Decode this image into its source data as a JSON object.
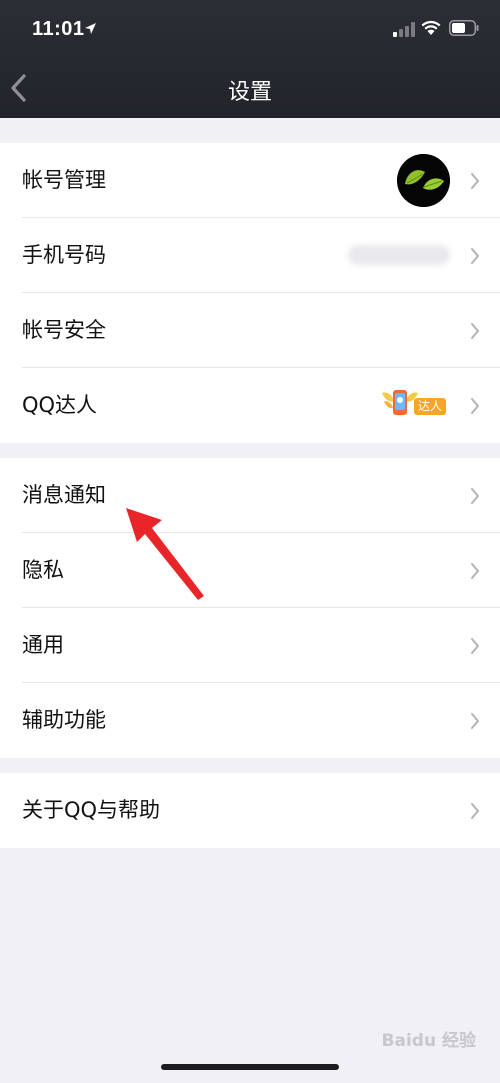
{
  "status_bar": {
    "time": "11:01"
  },
  "header": {
    "title": "设置"
  },
  "groups": [
    {
      "items": [
        {
          "label": "帐号管理"
        },
        {
          "label": "手机号码"
        },
        {
          "label": "帐号安全"
        },
        {
          "label": "QQ达人",
          "badge": "达人"
        }
      ]
    },
    {
      "items": [
        {
          "label": "消息通知"
        },
        {
          "label": "隐私"
        },
        {
          "label": "通用"
        },
        {
          "label": "辅助功能"
        }
      ]
    },
    {
      "items": [
        {
          "label": "关于QQ与帮助"
        }
      ]
    }
  ],
  "watermark": "Baidu 经验",
  "colors": {
    "header_bg": "#22242b",
    "page_bg": "#f0f0f5",
    "arrow": "#e8262a",
    "badge": "#f5a623"
  },
  "icons": [
    "location-arrow-icon",
    "signal-icon",
    "wifi-icon",
    "battery-icon",
    "back-chevron-icon",
    "chevron-right-icon",
    "leaf-avatar",
    "daren-wings-icon",
    "red-arrow-icon"
  ]
}
